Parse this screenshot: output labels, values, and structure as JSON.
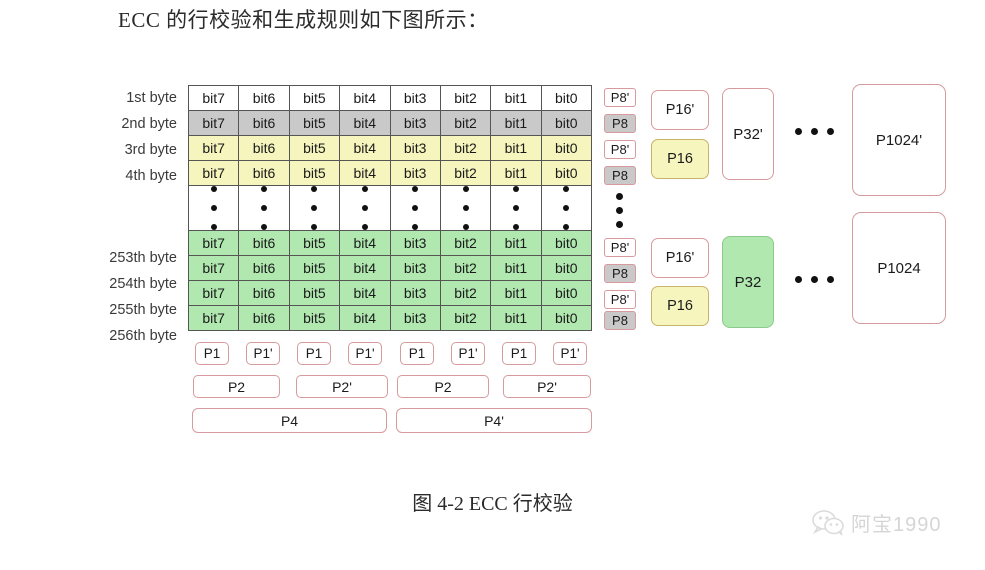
{
  "heading": "ECC 的行校验和生成规则如下图所示：",
  "caption": "图 4-2 ECC 行校验",
  "watermark": {
    "name": "阿宝1990",
    "icon": "wechat-icon"
  },
  "row_labels": [
    "1st byte",
    "2nd byte",
    "3rd byte",
    "4th byte",
    "253th byte",
    "254th byte",
    "255th byte",
    "256th byte"
  ],
  "bit_columns": [
    "bit7",
    "bit6",
    "bit5",
    "bit4",
    "bit3",
    "bit2",
    "bit1",
    "bit0"
  ],
  "grid_rows": [
    {
      "label": "1st byte",
      "fill": "white",
      "cells": [
        "bit7",
        "bit6",
        "bit5",
        "bit4",
        "bit3",
        "bit2",
        "bit1",
        "bit0"
      ]
    },
    {
      "label": "2nd byte",
      "fill": "gray",
      "cells": [
        "bit7",
        "bit6",
        "bit5",
        "bit4",
        "bit3",
        "bit2",
        "bit1",
        "bit0"
      ]
    },
    {
      "label": "3rd byte",
      "fill": "yellow",
      "cells": [
        "bit7",
        "bit6",
        "bit5",
        "bit4",
        "bit3",
        "bit2",
        "bit1",
        "bit0"
      ]
    },
    {
      "label": "4th byte",
      "fill": "yellow",
      "cells": [
        "bit7",
        "bit6",
        "bit5",
        "bit4",
        "bit3",
        "bit2",
        "bit1",
        "bit0"
      ]
    },
    {
      "label": "ellipsis",
      "fill": "white",
      "cells": [
        "",
        "",
        "",
        "",
        "",
        "",
        "",
        ""
      ]
    },
    {
      "label": "253th byte",
      "fill": "green",
      "cells": [
        "bit7",
        "bit6",
        "bit5",
        "bit4",
        "bit3",
        "bit2",
        "bit1",
        "bit0"
      ]
    },
    {
      "label": "254th byte",
      "fill": "green",
      "cells": [
        "bit7",
        "bit6",
        "bit5",
        "bit4",
        "bit3",
        "bit2",
        "bit1",
        "bit0"
      ]
    },
    {
      "label": "255th byte",
      "fill": "green",
      "cells": [
        "bit7",
        "bit6",
        "bit5",
        "bit4",
        "bit3",
        "bit2",
        "bit1",
        "bit0"
      ]
    },
    {
      "label": "256th byte",
      "fill": "green",
      "cells": [
        "bit7",
        "bit6",
        "bit5",
        "bit4",
        "bit3",
        "bit2",
        "bit1",
        "bit0"
      ]
    }
  ],
  "p8_column": [
    {
      "label": "P8'",
      "fill": "white"
    },
    {
      "label": "P8",
      "fill": "gray"
    },
    {
      "label": "P8'",
      "fill": "white"
    },
    {
      "label": "P8",
      "fill": "gray"
    },
    {
      "label": "P8'",
      "fill": "white"
    },
    {
      "label": "P8",
      "fill": "gray"
    },
    {
      "label": "P8'",
      "fill": "white"
    },
    {
      "label": "P8",
      "fill": "gray"
    }
  ],
  "p16_boxes": [
    {
      "label": "P16'",
      "fill": "white"
    },
    {
      "label": "P16",
      "fill": "yellow"
    },
    {
      "label": "P16'",
      "fill": "white"
    },
    {
      "label": "P16",
      "fill": "yellow"
    }
  ],
  "p32_boxes": [
    {
      "label": "P32'",
      "fill": "white"
    },
    {
      "label": "P32",
      "fill": "green"
    }
  ],
  "p1024_boxes": [
    {
      "label": "P1024'",
      "fill": "white"
    },
    {
      "label": "P1024",
      "fill": "white"
    }
  ],
  "p1_row": [
    "P1",
    "P1'",
    "P1",
    "P1'",
    "P1",
    "P1'",
    "P1",
    "P1'"
  ],
  "p2_row": [
    "P2",
    "P2'",
    "P2",
    "P2'"
  ],
  "p4_row": [
    "P4",
    "P4'"
  ],
  "ellipsis": {
    "vertical_dot_count": 3,
    "horizontal_dot_count": 3
  },
  "colors": {
    "gray_fill": "#c9c9c9",
    "yellow_fill": "#f6f5bd",
    "green_fill": "#b0e8b0",
    "pink_border": "#d79a9e",
    "grid_border": "#555555"
  }
}
